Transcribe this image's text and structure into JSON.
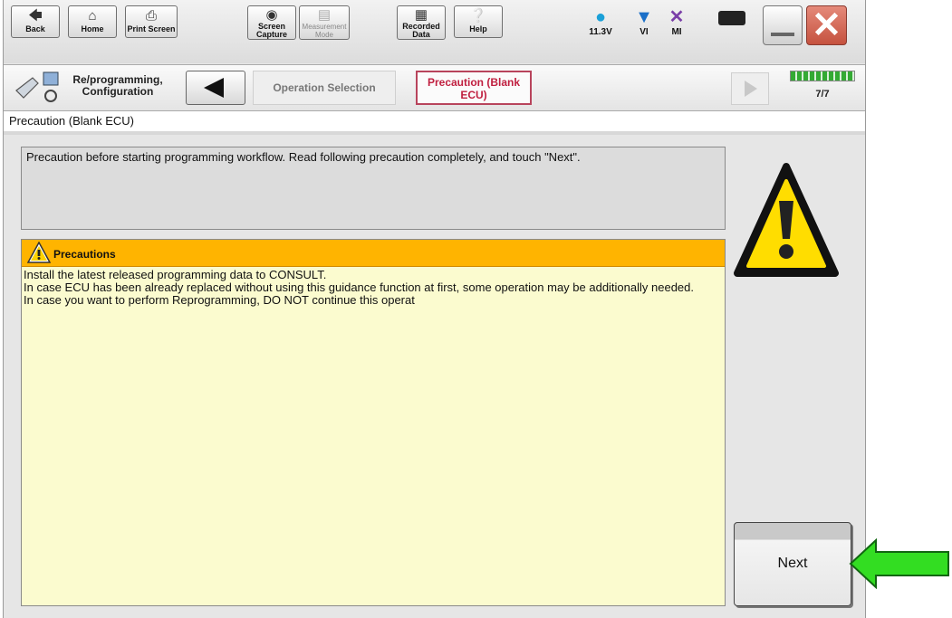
{
  "toolbar": {
    "buttons": [
      {
        "label": "Back"
      },
      {
        "label": "Home"
      },
      {
        "label": "Print Screen"
      },
      {
        "label": "Screen\nCapture"
      },
      {
        "label": "Measurement\nMode"
      },
      {
        "label": "Recorded\nData"
      },
      {
        "label": "Help"
      }
    ],
    "status": {
      "battery_voltage": "11.3V",
      "vi_label": "VI",
      "mi_label": "MI"
    }
  },
  "breadcrumb": {
    "section_label": "Re/programming,\nConfiguration",
    "operation_selection": "Operation Selection",
    "precaution": "Precaution (Blank\nECU)",
    "step_counter": "7/7",
    "progress_fraction": 1.0
  },
  "page": {
    "title": "Precaution (Blank ECU)",
    "instruction": "Precaution before starting programming workflow. Read following precaution completely, and touch \"Next\".",
    "precautions": {
      "title": "Precautions",
      "lines": [
        "Install the latest released programming data to CONSULT.",
        "In case ECU has been already replaced without using this guidance function at first, some operation may be additionally needed.",
        "In case you want to perform Reprogramming, DO NOT continue this operat"
      ]
    },
    "next_label": "Next"
  },
  "colors": {
    "precaution_header": "#ffb400",
    "precaution_body": "#fbfbcf",
    "active_crumb_text": "#c02040",
    "callout_arrow": "#33dd22"
  }
}
